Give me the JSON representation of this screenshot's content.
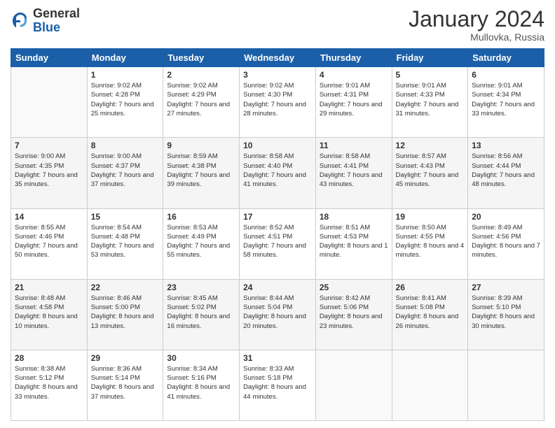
{
  "header": {
    "logo_general": "General",
    "logo_blue": "Blue",
    "month_title": "January 2024",
    "location": "Mullovka, Russia"
  },
  "days_of_week": [
    "Sunday",
    "Monday",
    "Tuesday",
    "Wednesday",
    "Thursday",
    "Friday",
    "Saturday"
  ],
  "weeks": [
    [
      {
        "day": "",
        "sunrise": "",
        "sunset": "",
        "daylight": ""
      },
      {
        "day": "1",
        "sunrise": "Sunrise: 9:02 AM",
        "sunset": "Sunset: 4:28 PM",
        "daylight": "Daylight: 7 hours and 25 minutes."
      },
      {
        "day": "2",
        "sunrise": "Sunrise: 9:02 AM",
        "sunset": "Sunset: 4:29 PM",
        "daylight": "Daylight: 7 hours and 27 minutes."
      },
      {
        "day": "3",
        "sunrise": "Sunrise: 9:02 AM",
        "sunset": "Sunset: 4:30 PM",
        "daylight": "Daylight: 7 hours and 28 minutes."
      },
      {
        "day": "4",
        "sunrise": "Sunrise: 9:01 AM",
        "sunset": "Sunset: 4:31 PM",
        "daylight": "Daylight: 7 hours and 29 minutes."
      },
      {
        "day": "5",
        "sunrise": "Sunrise: 9:01 AM",
        "sunset": "Sunset: 4:33 PM",
        "daylight": "Daylight: 7 hours and 31 minutes."
      },
      {
        "day": "6",
        "sunrise": "Sunrise: 9:01 AM",
        "sunset": "Sunset: 4:34 PM",
        "daylight": "Daylight: 7 hours and 33 minutes."
      }
    ],
    [
      {
        "day": "7",
        "sunrise": "Sunrise: 9:00 AM",
        "sunset": "Sunset: 4:35 PM",
        "daylight": "Daylight: 7 hours and 35 minutes."
      },
      {
        "day": "8",
        "sunrise": "Sunrise: 9:00 AM",
        "sunset": "Sunset: 4:37 PM",
        "daylight": "Daylight: 7 hours and 37 minutes."
      },
      {
        "day": "9",
        "sunrise": "Sunrise: 8:59 AM",
        "sunset": "Sunset: 4:38 PM",
        "daylight": "Daylight: 7 hours and 39 minutes."
      },
      {
        "day": "10",
        "sunrise": "Sunrise: 8:58 AM",
        "sunset": "Sunset: 4:40 PM",
        "daylight": "Daylight: 7 hours and 41 minutes."
      },
      {
        "day": "11",
        "sunrise": "Sunrise: 8:58 AM",
        "sunset": "Sunset: 4:41 PM",
        "daylight": "Daylight: 7 hours and 43 minutes."
      },
      {
        "day": "12",
        "sunrise": "Sunrise: 8:57 AM",
        "sunset": "Sunset: 4:43 PM",
        "daylight": "Daylight: 7 hours and 45 minutes."
      },
      {
        "day": "13",
        "sunrise": "Sunrise: 8:56 AM",
        "sunset": "Sunset: 4:44 PM",
        "daylight": "Daylight: 7 hours and 48 minutes."
      }
    ],
    [
      {
        "day": "14",
        "sunrise": "Sunrise: 8:55 AM",
        "sunset": "Sunset: 4:46 PM",
        "daylight": "Daylight: 7 hours and 50 minutes."
      },
      {
        "day": "15",
        "sunrise": "Sunrise: 8:54 AM",
        "sunset": "Sunset: 4:48 PM",
        "daylight": "Daylight: 7 hours and 53 minutes."
      },
      {
        "day": "16",
        "sunrise": "Sunrise: 8:53 AM",
        "sunset": "Sunset: 4:49 PM",
        "daylight": "Daylight: 7 hours and 55 minutes."
      },
      {
        "day": "17",
        "sunrise": "Sunrise: 8:52 AM",
        "sunset": "Sunset: 4:51 PM",
        "daylight": "Daylight: 7 hours and 58 minutes."
      },
      {
        "day": "18",
        "sunrise": "Sunrise: 8:51 AM",
        "sunset": "Sunset: 4:53 PM",
        "daylight": "Daylight: 8 hours and 1 minute."
      },
      {
        "day": "19",
        "sunrise": "Sunrise: 8:50 AM",
        "sunset": "Sunset: 4:55 PM",
        "daylight": "Daylight: 8 hours and 4 minutes."
      },
      {
        "day": "20",
        "sunrise": "Sunrise: 8:49 AM",
        "sunset": "Sunset: 4:56 PM",
        "daylight": "Daylight: 8 hours and 7 minutes."
      }
    ],
    [
      {
        "day": "21",
        "sunrise": "Sunrise: 8:48 AM",
        "sunset": "Sunset: 4:58 PM",
        "daylight": "Daylight: 8 hours and 10 minutes."
      },
      {
        "day": "22",
        "sunrise": "Sunrise: 8:46 AM",
        "sunset": "Sunset: 5:00 PM",
        "daylight": "Daylight: 8 hours and 13 minutes."
      },
      {
        "day": "23",
        "sunrise": "Sunrise: 8:45 AM",
        "sunset": "Sunset: 5:02 PM",
        "daylight": "Daylight: 8 hours and 16 minutes."
      },
      {
        "day": "24",
        "sunrise": "Sunrise: 8:44 AM",
        "sunset": "Sunset: 5:04 PM",
        "daylight": "Daylight: 8 hours and 20 minutes."
      },
      {
        "day": "25",
        "sunrise": "Sunrise: 8:42 AM",
        "sunset": "Sunset: 5:06 PM",
        "daylight": "Daylight: 8 hours and 23 minutes."
      },
      {
        "day": "26",
        "sunrise": "Sunrise: 8:41 AM",
        "sunset": "Sunset: 5:08 PM",
        "daylight": "Daylight: 8 hours and 26 minutes."
      },
      {
        "day": "27",
        "sunrise": "Sunrise: 8:39 AM",
        "sunset": "Sunset: 5:10 PM",
        "daylight": "Daylight: 8 hours and 30 minutes."
      }
    ],
    [
      {
        "day": "28",
        "sunrise": "Sunrise: 8:38 AM",
        "sunset": "Sunset: 5:12 PM",
        "daylight": "Daylight: 8 hours and 33 minutes."
      },
      {
        "day": "29",
        "sunrise": "Sunrise: 8:36 AM",
        "sunset": "Sunset: 5:14 PM",
        "daylight": "Daylight: 8 hours and 37 minutes."
      },
      {
        "day": "30",
        "sunrise": "Sunrise: 8:34 AM",
        "sunset": "Sunset: 5:16 PM",
        "daylight": "Daylight: 8 hours and 41 minutes."
      },
      {
        "day": "31",
        "sunrise": "Sunrise: 8:33 AM",
        "sunset": "Sunset: 5:18 PM",
        "daylight": "Daylight: 8 hours and 44 minutes."
      },
      {
        "day": "",
        "sunrise": "",
        "sunset": "",
        "daylight": ""
      },
      {
        "day": "",
        "sunrise": "",
        "sunset": "",
        "daylight": ""
      },
      {
        "day": "",
        "sunrise": "",
        "sunset": "",
        "daylight": ""
      }
    ]
  ]
}
